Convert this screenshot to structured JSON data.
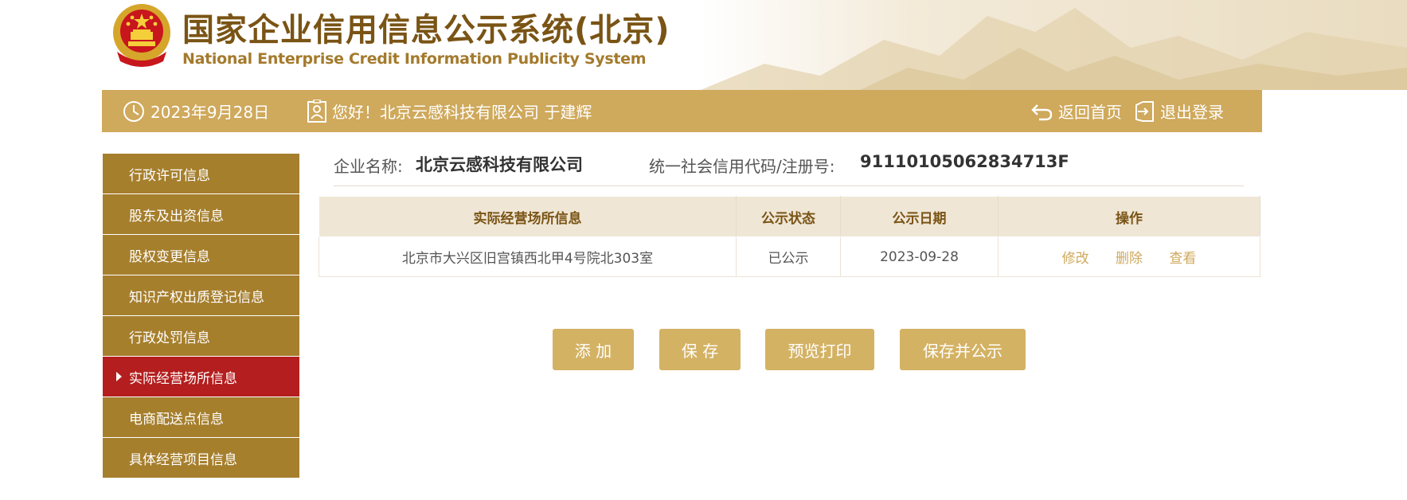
{
  "header": {
    "title_cn": "国家企业信用信息公示系统(北京)",
    "title_en": "National Enterprise Credit Information Publicity System"
  },
  "topbar": {
    "date": "2023年9月28日",
    "greeting": "您好！北京云感科技有限公司 于建辉",
    "home_label": "返回首页",
    "logout_label": "退出登录"
  },
  "sidebar": {
    "items": [
      {
        "label": "行政许可信息"
      },
      {
        "label": "股东及出资信息"
      },
      {
        "label": "股权变更信息"
      },
      {
        "label": "知识产权出质登记信息"
      },
      {
        "label": "行政处罚信息"
      },
      {
        "label": "实际经营场所信息",
        "active": true
      },
      {
        "label": "电商配送点信息"
      },
      {
        "label": "具体经营项目信息"
      }
    ]
  },
  "company": {
    "name_label": "企业名称:",
    "name_value": "北京云感科技有限公司",
    "code_label": "统一社会信用代码/注册号:",
    "code_value": "91110105062834713F"
  },
  "table": {
    "headers": [
      "实际经营场所信息",
      "公示状态",
      "公示日期",
      "操作"
    ],
    "rows": [
      {
        "address": "北京市大兴区旧宫镇西北甲4号院北303室",
        "status": "已公示",
        "date": "2023-09-28",
        "actions": [
          "修改",
          "删除",
          "查看"
        ]
      }
    ]
  },
  "buttons": {
    "add": "添 加",
    "save": "保 存",
    "preview": "预览打印",
    "save_publish": "保存并公示"
  },
  "colors": {
    "gold_bar": "#cfa95c",
    "sidebar_bg": "#a67f2d",
    "sidebar_active": "#b41e1e",
    "title_brown": "#7a5415",
    "button_gold": "#d4b264"
  },
  "icons": [
    "national-emblem",
    "clock-icon",
    "user-badge-icon",
    "return-icon",
    "logout-icon"
  ]
}
